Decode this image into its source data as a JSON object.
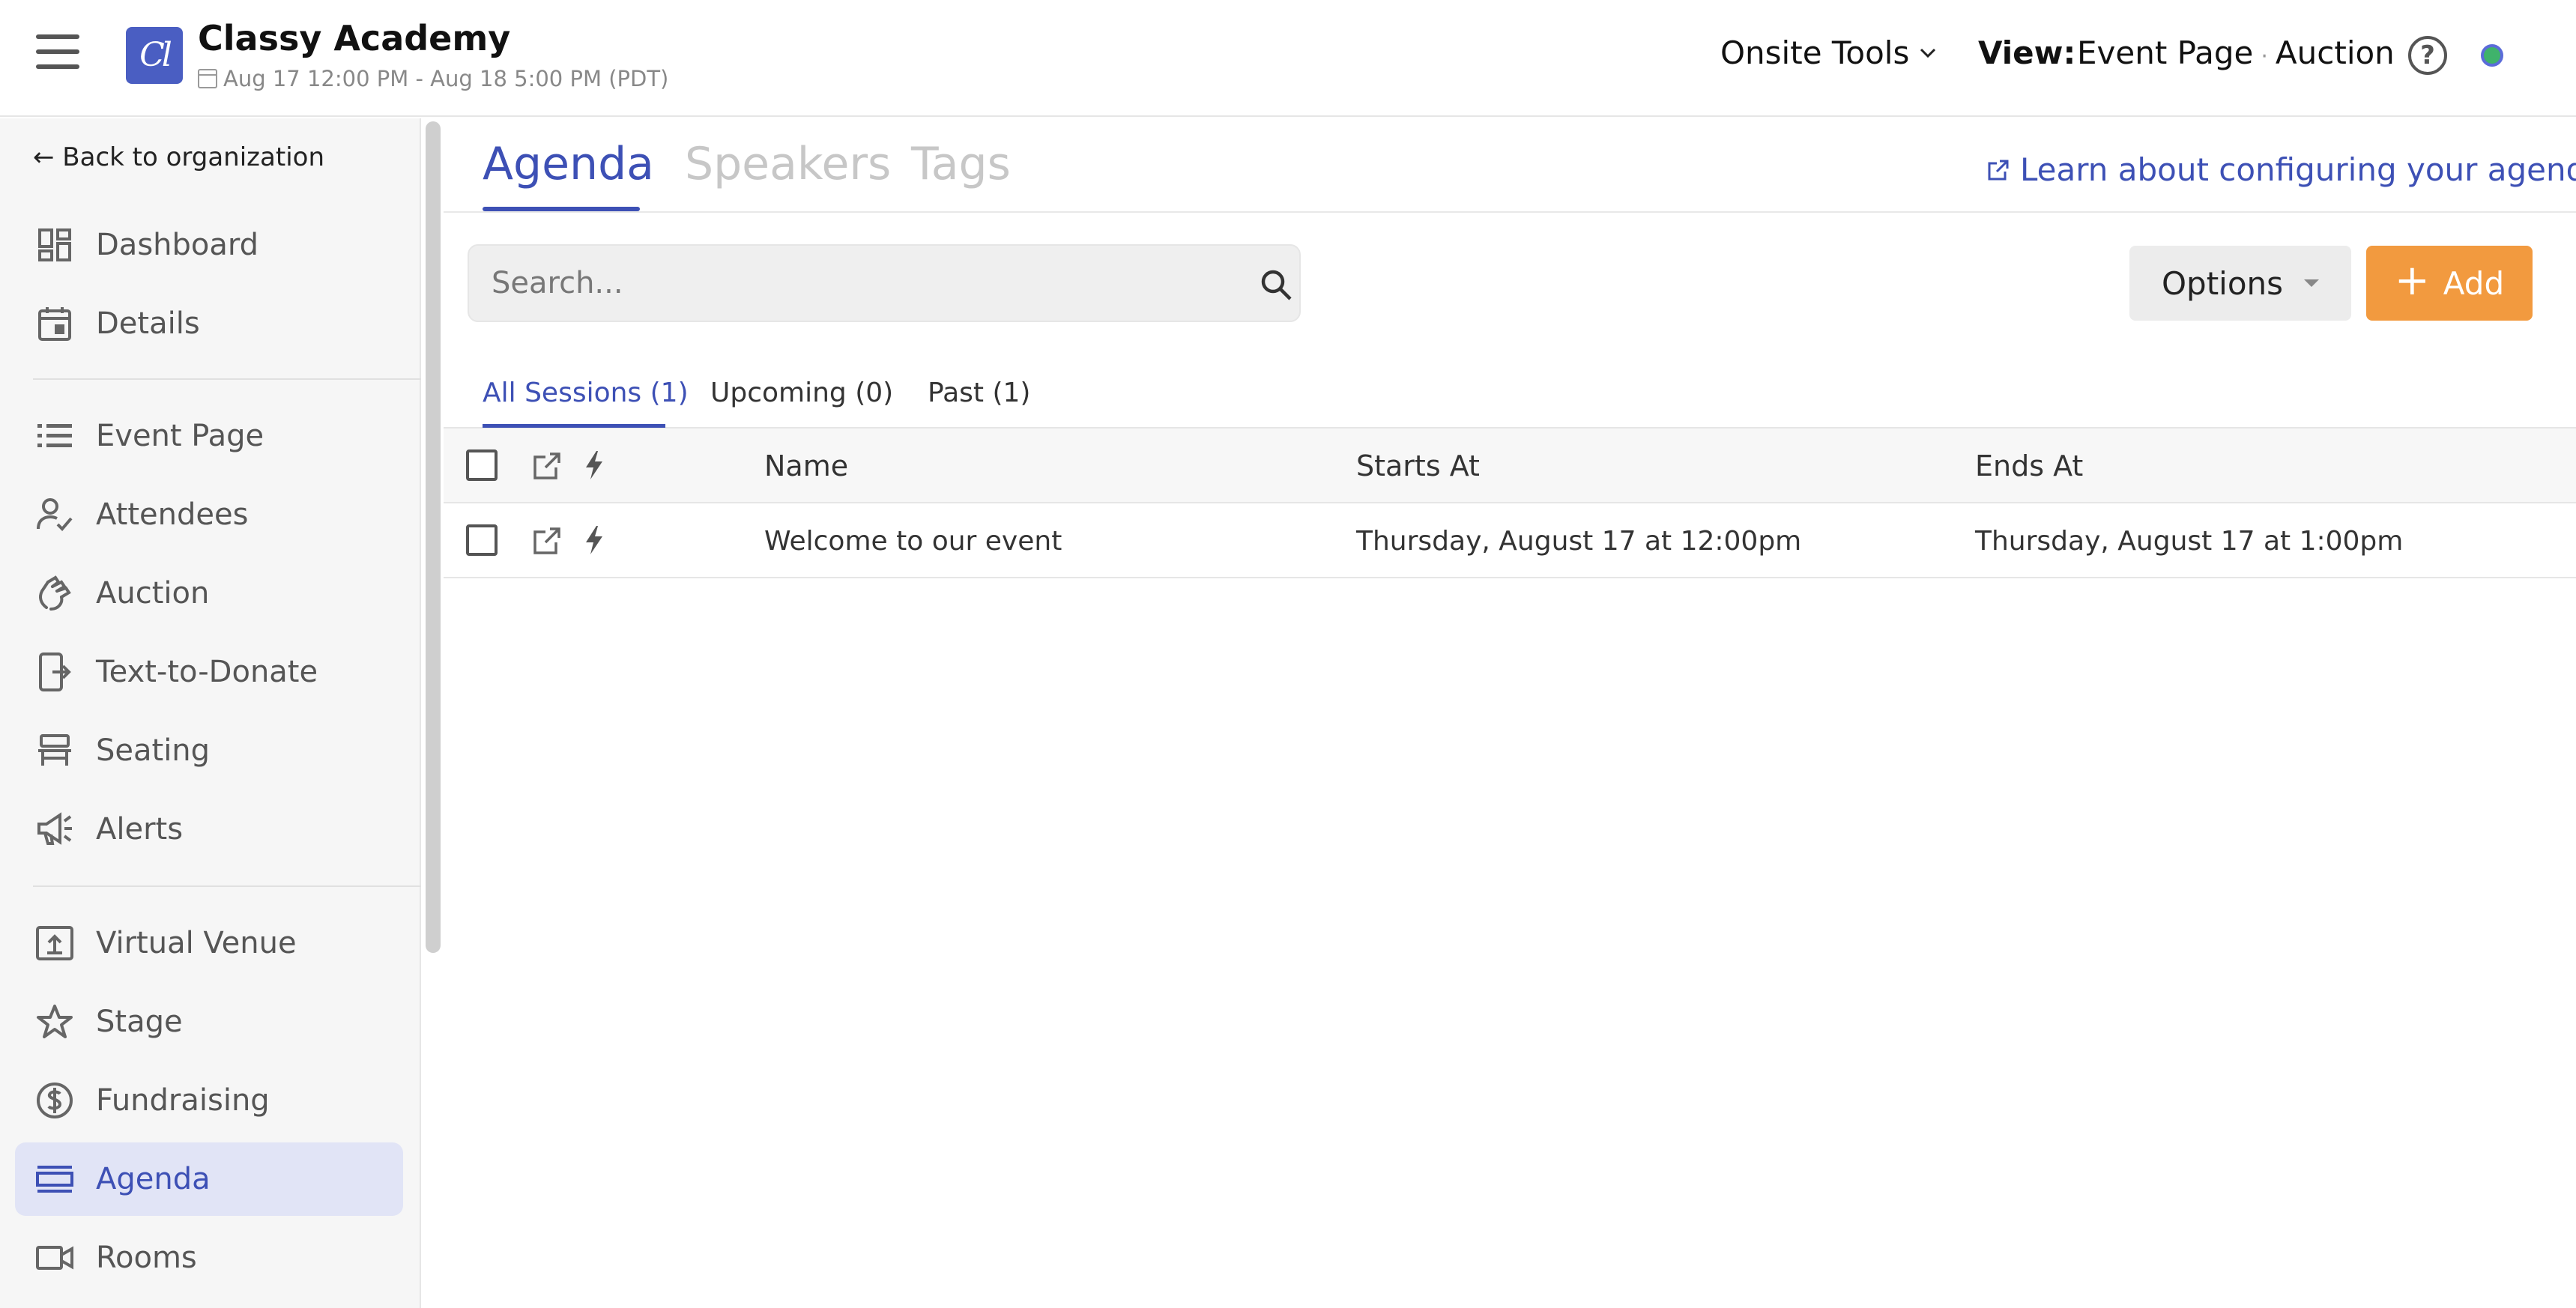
{
  "header": {
    "logo_text": "Cl",
    "org_title": "Classy Academy",
    "event_dates": "Aug 17 12:00 PM - Aug 18 5:00 PM (PDT)",
    "onsite_tools": "Onsite Tools",
    "view_label": "View:",
    "view_page": "Event Page",
    "view_auction": "Auction",
    "help_symbol": "?",
    "status_color": "#3fb36b"
  },
  "sidebar": {
    "back_link": "← Back to organization",
    "items": [
      {
        "label": "Dashboard",
        "icon": "dashboard-icon"
      },
      {
        "label": "Details",
        "icon": "calendar-icon"
      },
      {
        "label": "Event Page",
        "icon": "list-icon"
      },
      {
        "label": "Attendees",
        "icon": "person-check-icon"
      },
      {
        "label": "Auction",
        "icon": "hand-icon"
      },
      {
        "label": "Text-to-Donate",
        "icon": "phone-icon"
      },
      {
        "label": "Seating",
        "icon": "chair-icon"
      },
      {
        "label": "Alerts",
        "icon": "megaphone-icon"
      },
      {
        "label": "Virtual Venue",
        "icon": "upload-icon"
      },
      {
        "label": "Stage",
        "icon": "star-icon"
      },
      {
        "label": "Fundraising",
        "icon": "dollar-icon"
      },
      {
        "label": "Agenda",
        "icon": "agenda-icon",
        "active": true
      },
      {
        "label": "Rooms",
        "icon": "video-icon"
      }
    ]
  },
  "main": {
    "tabs": [
      "Agenda",
      "Speakers",
      "Tags"
    ],
    "learn_link": "Learn about configuring your agenda",
    "search_placeholder": "Search...",
    "options_label": "Options",
    "add_label": "Add",
    "filters": [
      "All Sessions (1)",
      "Upcoming (0)",
      "Past (1)"
    ],
    "columns": [
      "Name",
      "Starts At",
      "Ends At"
    ],
    "rows": [
      {
        "name": "Welcome to our event",
        "starts": "Thursday, August 17 at 12:00pm",
        "ends": "Thursday, August 17 at 1:00pm"
      }
    ]
  },
  "colors": {
    "accent": "#3d50b5",
    "add_button": "#f29a3f",
    "active_nav_bg": "#e1e4f6"
  }
}
